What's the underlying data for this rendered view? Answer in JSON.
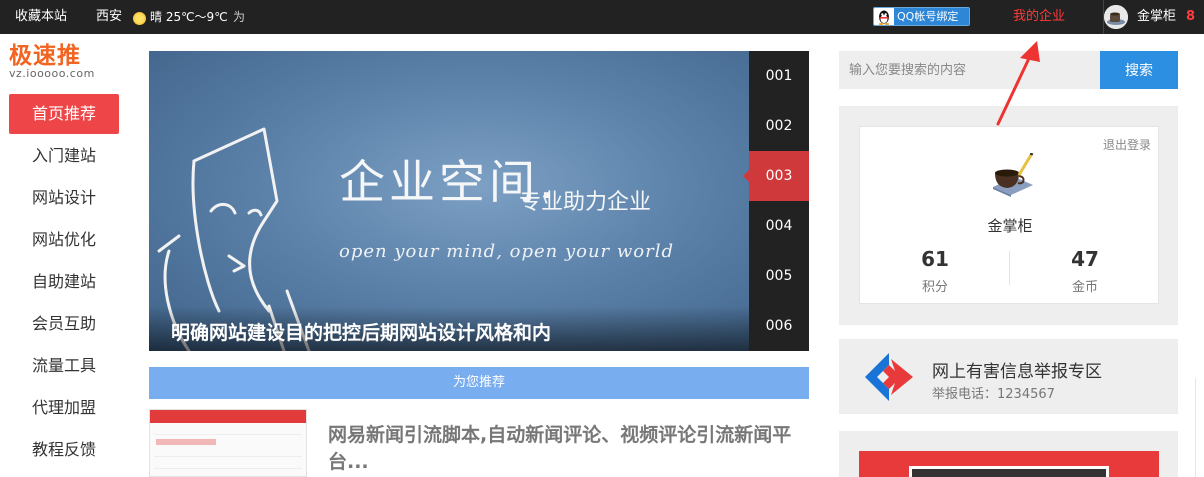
{
  "topbar": {
    "favorite": "收藏本站",
    "city": "西安",
    "weather": "晴 25℃～9℃",
    "sep": "为",
    "qq_bind": "QQ帐号绑定",
    "my_enterprise": "我的企业",
    "username": "金掌柜",
    "count": "8"
  },
  "logo": {
    "main": "极速推",
    "sub": "vz.iooooo.com"
  },
  "nav": {
    "items": [
      {
        "label": "首页推荐"
      },
      {
        "label": "入门建站"
      },
      {
        "label": "网站设计"
      },
      {
        "label": "网站优化"
      },
      {
        "label": "自助建站"
      },
      {
        "label": "会员互助"
      },
      {
        "label": "流量工具"
      },
      {
        "label": "代理加盟"
      },
      {
        "label": "教程反馈"
      }
    ]
  },
  "slider": {
    "big_text": "企业空间.",
    "small_text": "专业助力企业",
    "english": "open your mind, open your world",
    "caption": "明确网站建设目的把控后期网站设计风格和内",
    "tabs": [
      "001",
      "002",
      "003",
      "004",
      "005",
      "006"
    ],
    "active_tab": "003"
  },
  "recommend": {
    "label": "为您推荐"
  },
  "article": {
    "title": "网易新闻引流脚本,自动新闻评论、视频评论引流新闻平台..."
  },
  "search": {
    "placeholder": "输入您要搜索的内容",
    "button": "搜索"
  },
  "user_card": {
    "logout": "退出登录",
    "name": "金掌柜",
    "points_value": "61",
    "points_label": "积分",
    "coins_value": "47",
    "coins_label": "金币"
  },
  "report": {
    "title": "网上有害信息举报专区",
    "tel": "举报电话：1234567"
  },
  "colors": {
    "topbar_bg": "#222222",
    "accent_red": "#ee4548",
    "search_blue": "#2d8fe2",
    "recommend_blue": "#78aef0",
    "logo_orange": "#f26422"
  }
}
